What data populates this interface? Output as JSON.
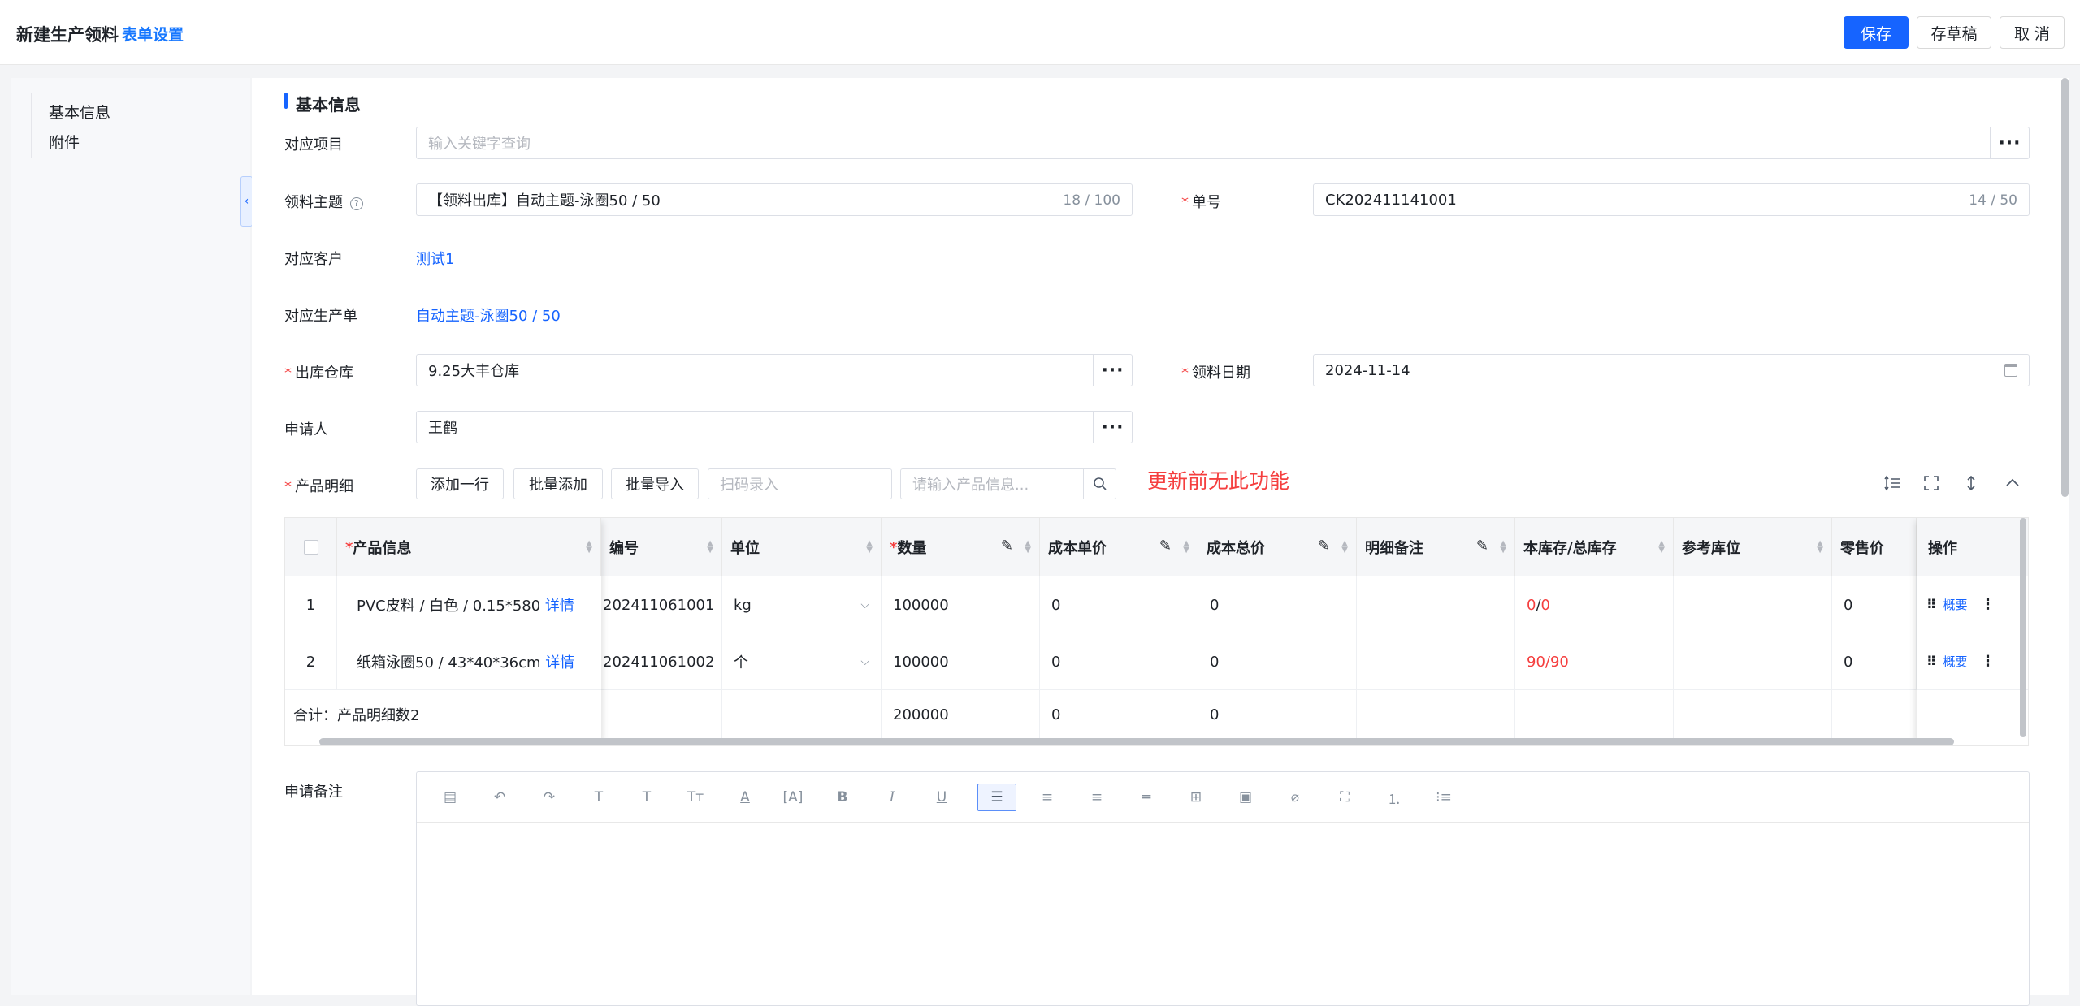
{
  "header": {
    "title": "新建生产领料",
    "form_settings": "表单设置",
    "save": "保存",
    "draft": "存草稿",
    "cancel": "取 消"
  },
  "sidebar": {
    "items": [
      {
        "label": "基本信息"
      },
      {
        "label": "附件"
      }
    ],
    "collapse_glyph": "‹"
  },
  "section": {
    "title": "基本信息"
  },
  "form": {
    "project": {
      "label": "对应项目",
      "placeholder": "输入关键字查询"
    },
    "subject": {
      "label": "领料主题",
      "help_glyph": "?",
      "value": "【领料出库】自动主题-泳圈50 / 50",
      "count": "18 / 100"
    },
    "number": {
      "label": "单号",
      "value": "CK202411141001",
      "count": "14 / 50"
    },
    "customer": {
      "label": "对应客户",
      "value": "测试1"
    },
    "production_order": {
      "label": "对应生产单",
      "value": "自动主题-泳圈50 / 50"
    },
    "warehouse": {
      "label": "出库仓库",
      "value": "9.25大丰仓库"
    },
    "date": {
      "label": "领料日期",
      "value": "2024-11-14"
    },
    "applicant": {
      "label": "申请人",
      "value": "王鹤"
    },
    "dots": "···",
    "detail": {
      "label": "产品明细",
      "add_row": "添加一行",
      "batch_add": "批量添加",
      "batch_import": "批量导入",
      "scan_placeholder": "扫码录入",
      "search_placeholder": "请输入产品信息..."
    },
    "annotation": "更新前无此功能",
    "remark_label": "申请备注"
  },
  "table": {
    "headers": {
      "product": "产品信息",
      "code": "编号",
      "unit": "单位",
      "qty": "数量",
      "unit_cost": "成本单价",
      "total_cost": "成本总价",
      "remark": "明细备注",
      "stock": "本库存/总库存",
      "location": "参考库位",
      "retail": "零售价",
      "ops": "操作"
    },
    "rows": [
      {
        "index": "1",
        "product": "PVC皮料 / 白色 / 0.15*580",
        "detail": "详情",
        "code": "202411061001",
        "unit": "kg",
        "qty": "100000",
        "unit_cost": "0",
        "total_cost": "0",
        "stock_a": "0",
        "stock_b": "0",
        "retail": "0",
        "op": "概要"
      },
      {
        "index": "2",
        "product": "纸箱泳圈50 / 43*40*36cm",
        "detail": "详情",
        "code": "202411061002",
        "unit": "个",
        "qty": "100000",
        "unit_cost": "0",
        "total_cost": "0",
        "stock_a": "90",
        "stock_b": "90",
        "retail": "0",
        "op": "概要"
      }
    ],
    "summary": {
      "label": "合计：产品明细数2",
      "qty": "200000",
      "unit_cost": "0",
      "total_cost": "0"
    }
  }
}
